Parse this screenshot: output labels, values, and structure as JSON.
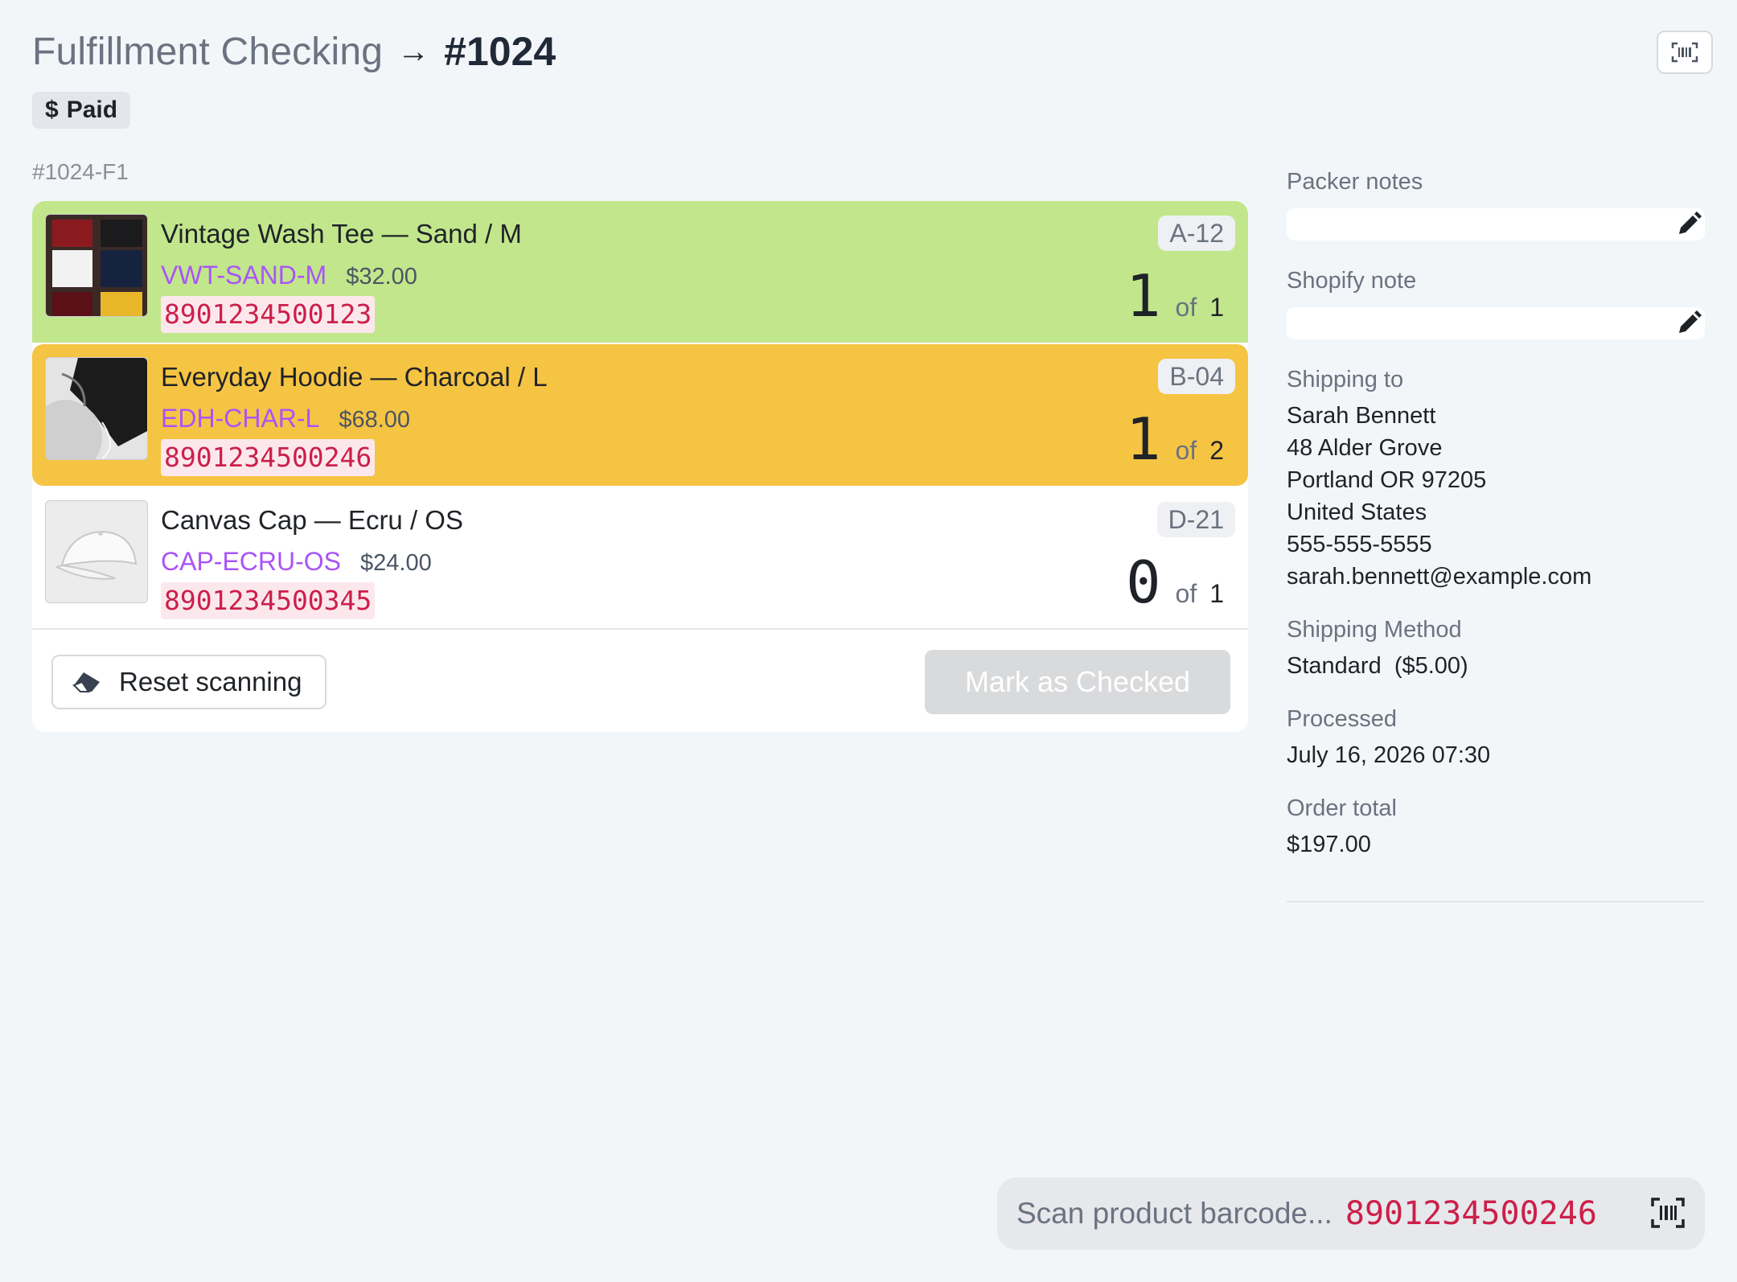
{
  "header": {
    "title": "Fulfillment Checking",
    "arrow": "→",
    "order_number": "#1024"
  },
  "status_badge": {
    "symbol": "$",
    "label": "Paid"
  },
  "fulfillment_id": "#1024-F1",
  "items": [
    {
      "name": "Vintage Wash Tee — Sand / M",
      "sku": "VWT-SAND-M",
      "price": "$32.00",
      "barcode": "8901234500123",
      "bin": "A-12",
      "scanned": "1",
      "of_label": "of",
      "quantity": "1",
      "state_color": "#c2e68c"
    },
    {
      "name": "Everyday Hoodie — Charcoal / L",
      "sku": "EDH-CHAR-L",
      "price": "$68.00",
      "barcode": "8901234500246",
      "bin": "B-04",
      "scanned": "1",
      "of_label": "of",
      "quantity": "2",
      "state_color": "#f6c443"
    },
    {
      "name": "Canvas Cap — Ecru / OS",
      "sku": "CAP-ECRU-OS",
      "price": "$24.00",
      "barcode": "8901234500345",
      "bin": "D-21",
      "scanned": "0",
      "of_label": "of",
      "quantity": "1",
      "state_color": "#ffffff"
    }
  ],
  "actions": {
    "reset_label": "Reset scanning",
    "mark_checked_label": "Mark as Checked"
  },
  "sidebar": {
    "packer_notes_label": "Packer notes",
    "shopify_note_label": "Shopify note",
    "shipping_to_label": "Shipping to",
    "address": {
      "name": "Sarah Bennett",
      "street": "48 Alder Grove",
      "city_line": "Portland OR 97205",
      "country": "United States",
      "phone": "555-555-5555",
      "email": "sarah.bennett@example.com"
    },
    "shipping_method_label": "Shipping Method",
    "shipping_method": "Standard  ($5.00)",
    "processed_label": "Processed",
    "processed": "July 16, 2026 07:30",
    "order_total_label": "Order total",
    "order_total": "$197.00"
  },
  "scan": {
    "placeholder": "Scan product barcode...",
    "value": "8901234500246"
  },
  "icons": {
    "top_scan": "barcode-scan-icon",
    "reset": "eraser-icon",
    "edit": "pencil-icon",
    "bottom_scan": "barcode-scan-icon"
  }
}
